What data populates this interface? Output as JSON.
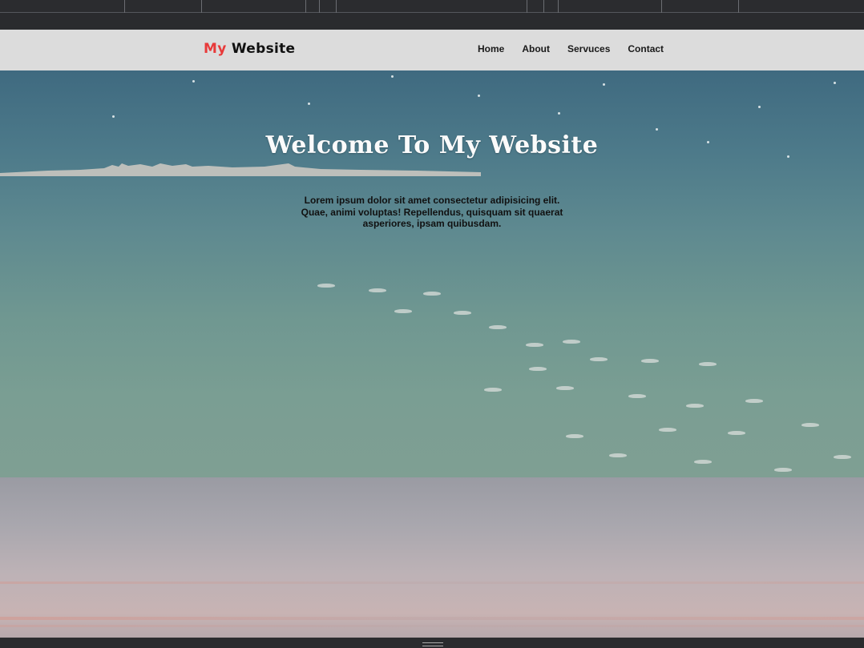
{
  "navbar": {
    "logo": {
      "part1": "My",
      "part2": "Website"
    },
    "links": [
      "Home",
      "About",
      "Servuces",
      "Contact"
    ]
  },
  "hero": {
    "title": "Welcome To My Website",
    "text": "Lorem ipsum dolor sit amet consectetur adipisicing elit. Quae, animi voluptas! Repellendus, quisquam sit quaerat asperiores, ipsam quibusdam."
  },
  "colors": {
    "logo_accent": "#e83a3a",
    "navbar_bg": "#dcdcdc"
  }
}
